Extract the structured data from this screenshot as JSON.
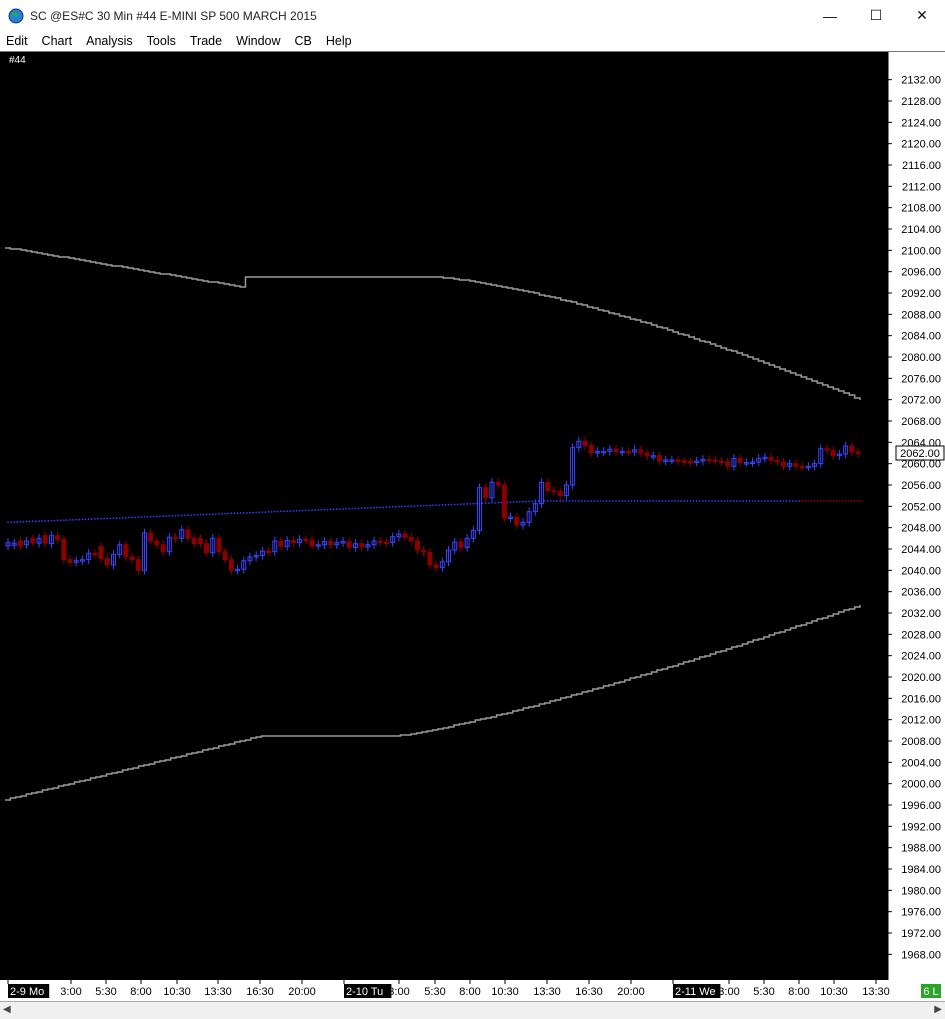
{
  "window": {
    "title": "SC @ES#C  30 Min   #44  E-MINI SP 500 MARCH 2015",
    "minimize": "—",
    "maximize": "☐",
    "close": "✕"
  },
  "menu": [
    "Edit",
    "Chart",
    "Analysis",
    "Tools",
    "Trade",
    "Window",
    "CB",
    "Help"
  ],
  "chart_label": "#44",
  "current_price": "2062.00",
  "indicator_badge": "6 L",
  "colors": {
    "background": "#000000",
    "up": "#3c44ff",
    "down": "#8b0000",
    "band": "#9a9a9a",
    "mid_up": "#2f40ff",
    "mid_down": "#9b0000"
  },
  "chart_data": {
    "type": "candlestick",
    "y_axis": {
      "ylim": [
        1966,
        2134
      ],
      "ticks": [
        "2132.00",
        "2128.00",
        "2124.00",
        "2120.00",
        "2116.00",
        "2112.00",
        "2108.00",
        "2104.00",
        "2100.00",
        "2096.00",
        "2092.00",
        "2088.00",
        "2084.00",
        "2080.00",
        "2076.00",
        "2072.00",
        "2068.00",
        "2064.00",
        "2060.00",
        "2056.00",
        "2052.00",
        "2048.00",
        "2044.00",
        "2040.00",
        "2036.00",
        "2032.00",
        "2028.00",
        "2024.00",
        "2020.00",
        "2016.00",
        "2012.00",
        "2008.00",
        "2004.00",
        "2000.00",
        "1996.00",
        "1992.00",
        "1988.00",
        "1984.00",
        "1980.00",
        "1976.00",
        "1972.00",
        "1968.00"
      ]
    },
    "x_axis": {
      "labels": [
        "2-9 Mo",
        "3:00",
        "5:30",
        "8:00",
        "10:30",
        "13:30",
        "16:30",
        "20:00",
        "2-10 Tu",
        "3:00",
        "5:30",
        "8:00",
        "10:30",
        "13:30",
        "16:30",
        "20:00",
        "2-11 We",
        "3:00",
        "5:30",
        "8:00",
        "10:30",
        "13:30"
      ],
      "boxed": [
        "2-9 Mo",
        "2-10 Tu",
        "2-11 We"
      ]
    },
    "close": [
      2045.2,
      2045.1,
      2044.6,
      2045.5,
      2045.2,
      2046.0,
      2045.1,
      2046.5,
      2045.8,
      2042.0,
      2041.5,
      2041.8,
      2042.0,
      2043.2,
      2043.0,
      2042.2,
      2041.0,
      2043.0,
      2044.8,
      2042.5,
      2042.0,
      2040.0,
      2047.0,
      2045.5,
      2044.8,
      2043.5,
      2046.2,
      2046.0,
      2047.6,
      2046.0,
      2045.0,
      2045.0,
      2043.3,
      2046.0,
      2043.5,
      2042.0,
      2040.0,
      2040.2,
      2041.8,
      2042.5,
      2042.8,
      2043.6,
      2043.5,
      2045.5,
      2044.5,
      2045.6,
      2045.2,
      2045.8,
      2045.7,
      2044.6,
      2044.8,
      2045.4,
      2044.8,
      2045.2,
      2045.4,
      2044.3,
      2045.0,
      2044.4,
      2044.8,
      2045.5,
      2045.3,
      2045.2,
      2046.3,
      2046.8,
      2046.2,
      2045.5,
      2043.8,
      2043.4,
      2041.0,
      2040.5,
      2041.6,
      2043.8,
      2045.3,
      2044.3,
      2046.0,
      2047.5,
      2055.5,
      2053.6,
      2056.5,
      2056.0,
      2049.8,
      2050.0,
      2048.5,
      2049.0,
      2051.0,
      2052.5,
      2056.5,
      2055.0,
      2054.8,
      2054.0,
      2056.0,
      2063.0,
      2064.2,
      2063.4,
      2062.0,
      2062.3,
      2062.3,
      2062.7,
      2062.2,
      2062.3,
      2062.2,
      2062.6,
      2062.0,
      2061.5,
      2061.5,
      2060.5,
      2060.7,
      2060.7,
      2060.5,
      2060.4,
      2060.3,
      2060.5,
      2060.8,
      2060.7,
      2060.5,
      2060.4,
      2059.5,
      2061.0,
      2060.2,
      2060.2,
      2060.3,
      2061.0,
      2061.2,
      2060.6,
      2060.3,
      2059.5,
      2060.0,
      2059.5,
      2059.4,
      2059.5,
      2060.0,
      2062.8,
      2062.5,
      2061.5,
      2061.8,
      2063.3,
      2062.2,
      2061.9
    ],
    "open": [
      2044.6,
      2044.7,
      2045.5,
      2044.8,
      2046.0,
      2045.1,
      2046.5,
      2045.0,
      2046.5,
      2045.8,
      2042.0,
      2041.5,
      2041.8,
      2042.0,
      2043.2,
      2044.5,
      2042.2,
      2041.0,
      2043.0,
      2044.8,
      2042.5,
      2042.0,
      2040.0,
      2047.0,
      2045.5,
      2044.8,
      2043.5,
      2046.2,
      2046.0,
      2047.6,
      2046.0,
      2046.0,
      2045.0,
      2043.3,
      2046.0,
      2043.5,
      2042.0,
      2040.0,
      2040.2,
      2041.8,
      2042.5,
      2042.8,
      2043.6,
      2043.5,
      2045.5,
      2044.5,
      2045.6,
      2045.2,
      2045.8,
      2045.7,
      2044.6,
      2044.8,
      2045.4,
      2044.8,
      2045.2,
      2045.4,
      2044.3,
      2045.0,
      2044.4,
      2044.8,
      2045.5,
      2045.3,
      2045.2,
      2046.3,
      2046.8,
      2046.2,
      2045.5,
      2043.8,
      2043.4,
      2041.0,
      2040.5,
      2041.6,
      2043.8,
      2045.3,
      2044.3,
      2046.0,
      2047.5,
      2055.5,
      2053.6,
      2056.5,
      2056.0,
      2049.8,
      2050.0,
      2048.5,
      2049.0,
      2051.0,
      2052.5,
      2056.5,
      2055.0,
      2054.8,
      2054.0,
      2056.0,
      2063.0,
      2064.2,
      2063.4,
      2062.0,
      2062.3,
      2062.3,
      2062.7,
      2062.2,
      2062.3,
      2062.2,
      2062.6,
      2062.0,
      2061.5,
      2061.5,
      2060.5,
      2060.7,
      2060.7,
      2060.5,
      2060.4,
      2060.3,
      2060.5,
      2060.8,
      2060.7,
      2060.5,
      2060.4,
      2059.5,
      2061.0,
      2060.2,
      2060.2,
      2060.3,
      2061.0,
      2061.2,
      2060.6,
      2060.3,
      2059.5,
      2060.0,
      2059.5,
      2059.4,
      2059.5,
      2060.0,
      2062.8,
      2062.5,
      2061.5,
      2061.8,
      2063.3,
      2062.2
    ],
    "upper_band": {
      "start": 2100.5,
      "end": 2072.0
    },
    "lower_band": {
      "start": 1997.0,
      "end": 2033.5
    },
    "midline": {
      "start": 2049.0,
      "end": 2053.0
    }
  }
}
